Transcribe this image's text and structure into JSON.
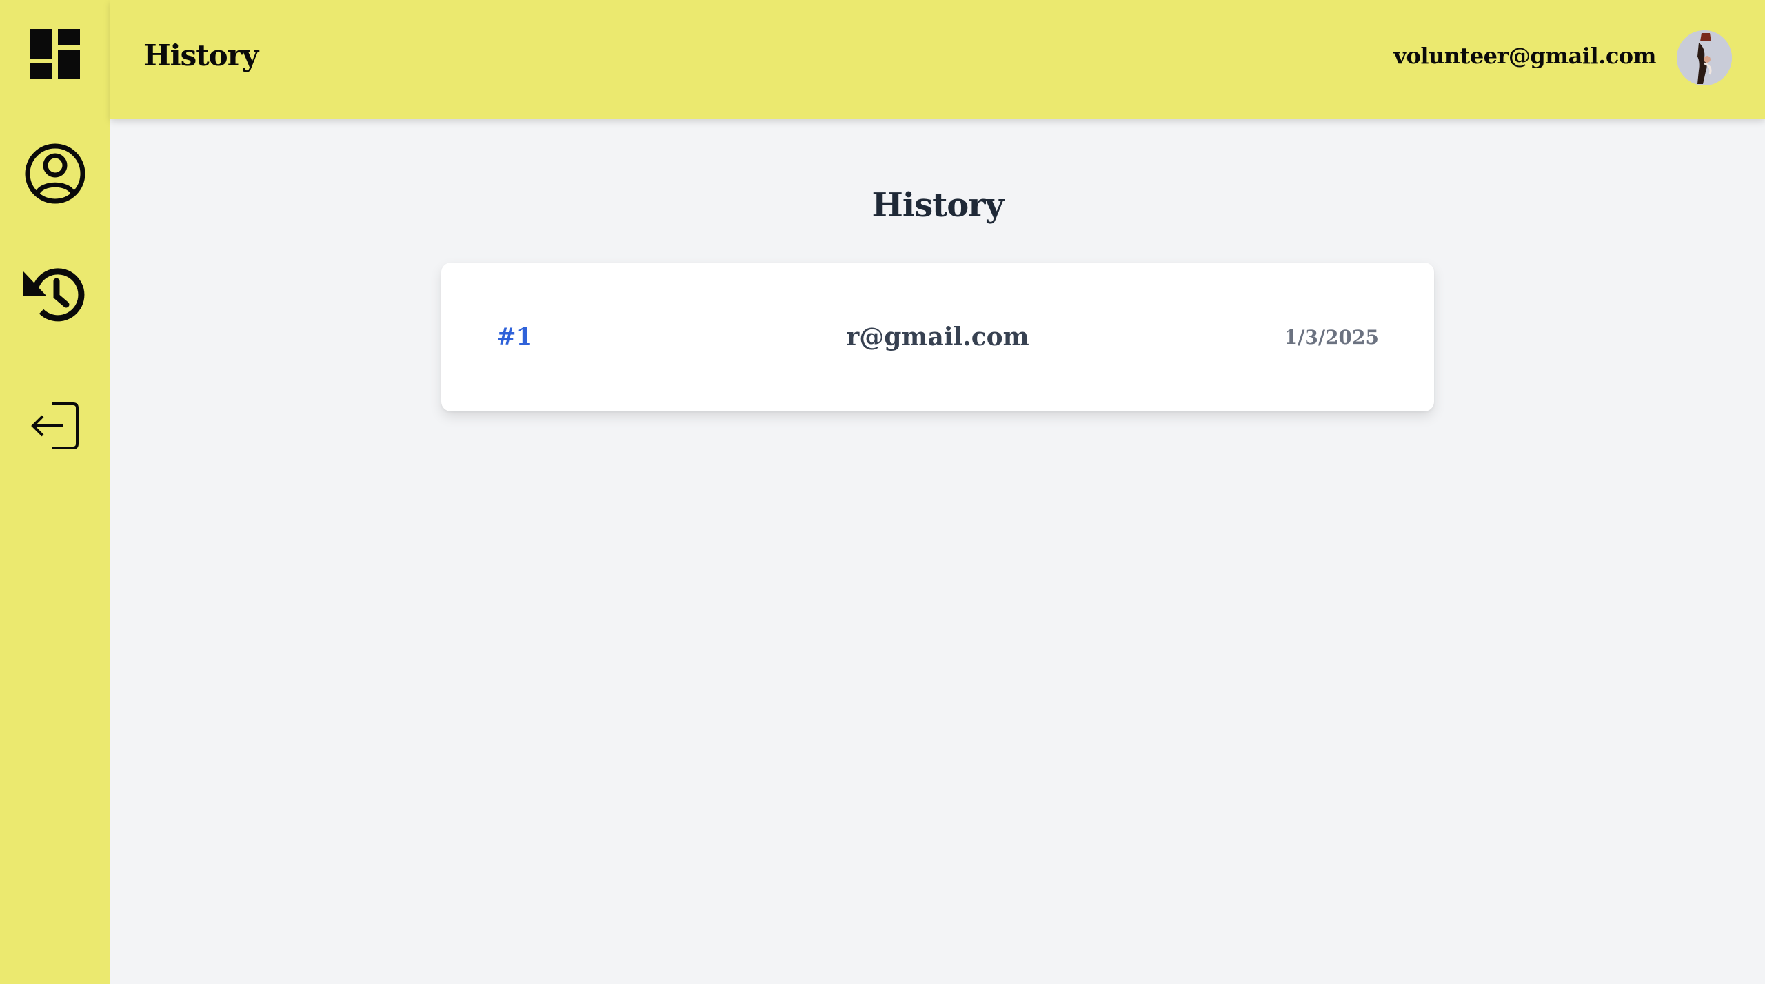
{
  "header": {
    "title": "History",
    "user_email": "volunteer@gmail.com"
  },
  "sidebar": {
    "items": [
      {
        "icon": "dashboard-icon"
      },
      {
        "icon": "profile-icon"
      },
      {
        "icon": "history-icon"
      },
      {
        "icon": "logout-icon"
      }
    ]
  },
  "main": {
    "heading": "History",
    "entries": [
      {
        "id": "#1",
        "email": "r@gmail.com",
        "date": "1/3/2025"
      }
    ]
  },
  "colors": {
    "accent_yellow": "#ebe96f",
    "background": "#f3f4f6",
    "id_blue": "#2f62d9",
    "text_dark": "#1f2937",
    "text_muted": "#6b7280"
  }
}
